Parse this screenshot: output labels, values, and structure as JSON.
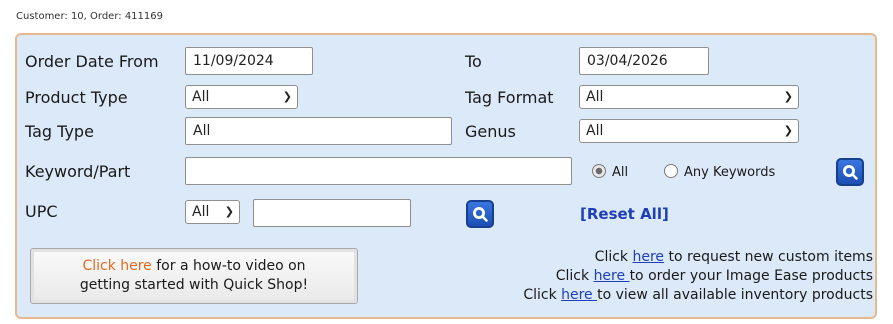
{
  "header": {
    "customer_info": "Customer: 10, Order: 411169"
  },
  "filters": {
    "order_date_from": {
      "label": "Order Date From",
      "value": "11/09/2024"
    },
    "order_date_to": {
      "label": "To",
      "value": "03/04/2026"
    },
    "product_type": {
      "label": "Product Type",
      "value": "All"
    },
    "tag_format": {
      "label": "Tag Format",
      "value": "All"
    },
    "tag_type": {
      "label": "Tag Type",
      "value": "All"
    },
    "genus": {
      "label": "Genus",
      "value": "All"
    },
    "keyword": {
      "label": "Keyword/Part",
      "value": "",
      "radio_all": "All",
      "radio_any": "Any Keywords",
      "selected": "All"
    },
    "upc": {
      "label": "UPC",
      "select_value": "All",
      "value": ""
    },
    "reset_label": "[Reset All]"
  },
  "howto": {
    "highlight": "Click here",
    "text1": " for a how-to video on",
    "text2": "getting started with Quick Shop!"
  },
  "links": [
    {
      "prefix": "Click ",
      "link": "here",
      "suffix": " to request new custom items"
    },
    {
      "prefix": "Click ",
      "link": "here ",
      "suffix": "to order your Image Ease products"
    },
    {
      "prefix": "Click ",
      "link": "here ",
      "suffix": "to view all available inventory products"
    }
  ],
  "colors": {
    "panel_bg": "#dbe9f8",
    "panel_border": "#e7b98f",
    "link": "#1f3fb8",
    "search_button": "#2a62cc",
    "howto_highlight": "#e06a20"
  },
  "icons": {
    "search_button": "magnifier-icon",
    "dropdown": "chevron-down-icon"
  }
}
